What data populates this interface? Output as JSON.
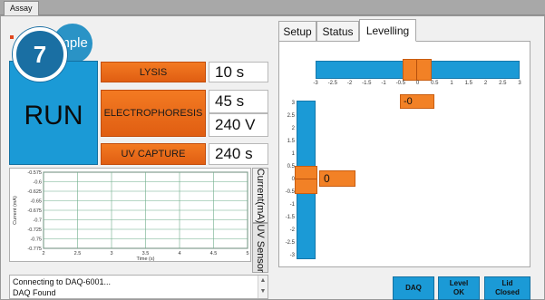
{
  "window": {
    "tab_label": "Assay"
  },
  "logo": {
    "text": "imple"
  },
  "step": {
    "number": "7"
  },
  "run": {
    "label": "RUN"
  },
  "processes": {
    "lysis": {
      "label": "LYSIS",
      "value": "10 s"
    },
    "electrophoresis": {
      "label": "ELECTROPHORESIS",
      "time": "45 s",
      "voltage": "240 V"
    },
    "uv_capture": {
      "label": "UV CAPTURE",
      "value": "240 s"
    }
  },
  "chart_data": {
    "type": "line",
    "xlabel": "Time (s)",
    "ylabel": "Current (mA)",
    "xlim": [
      2,
      5
    ],
    "ylim": [
      -0.775,
      -0.575
    ],
    "x_ticks": [
      "2",
      "2.5",
      "3",
      "3.5",
      "4",
      "4.5",
      "5"
    ],
    "y_ticks": [
      "-0.575",
      "-0.6",
      "-0.625",
      "-0.65",
      "-0.675",
      "-0.7",
      "-0.725",
      "-0.75",
      "-0.775"
    ],
    "grid": true,
    "series": []
  },
  "side_tabs": {
    "current": "Current(mA)",
    "uv_sensor": "UV Sensor"
  },
  "log": {
    "lines": [
      "Connecting to DAQ-6001...",
      "DAQ Found"
    ]
  },
  "right_tabs": {
    "setup": "Setup",
    "status": "Status",
    "levelling": "Levelling"
  },
  "levelling": {
    "horizontal": {
      "value": 0,
      "display": "-0",
      "range": [
        -3,
        3
      ],
      "ticks": [
        "-3",
        "-2.5",
        "-2",
        "-1.5",
        "-1",
        "-0.5",
        "0",
        "0.5",
        "1",
        "1.5",
        "2",
        "2.5",
        "3"
      ]
    },
    "vertical": {
      "value": 0,
      "display": "0",
      "range": [
        -3,
        3
      ],
      "ticks": [
        "3",
        "2.5",
        "2",
        "1.5",
        "1",
        "0.5",
        "0",
        "-0.5",
        "-1",
        "-1.5",
        "-2",
        "-2.5",
        "-3"
      ]
    }
  },
  "status_buttons": {
    "daq": "DAQ",
    "level_line1": "Level",
    "level_line2": "OK",
    "lid_line1": "Lid",
    "lid_line2": "Closed"
  },
  "colors": {
    "accent_blue": "#1b9ad6",
    "accent_orange": "#f28126",
    "step_blue": "#1a6fa3"
  }
}
